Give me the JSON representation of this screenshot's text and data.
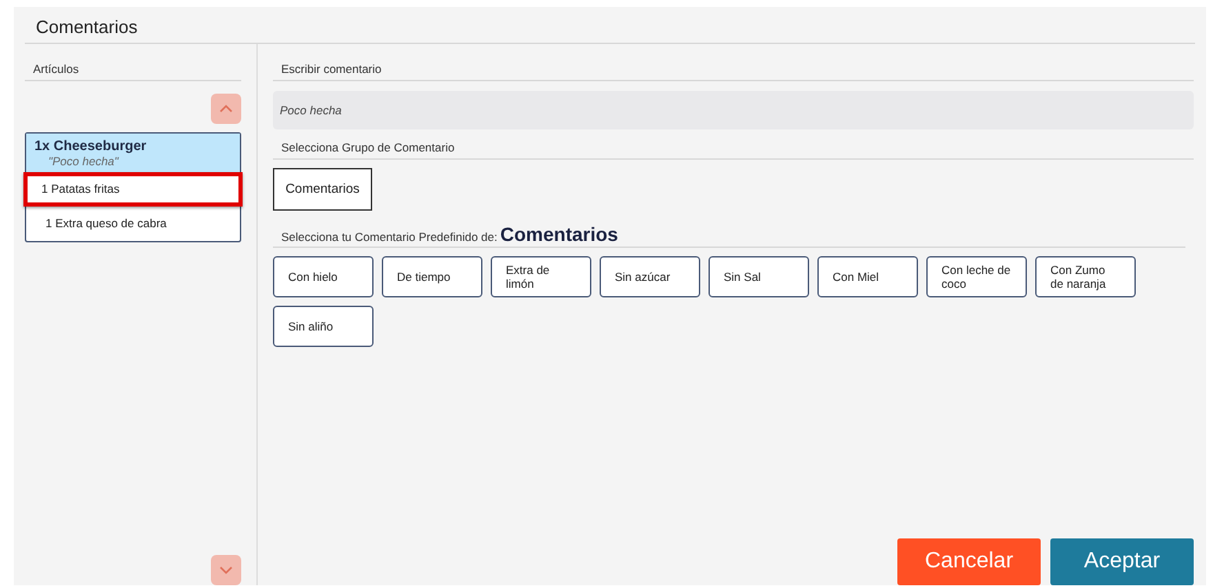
{
  "title": "Comentarios",
  "articles": {
    "heading": "Artículos",
    "items": [
      {
        "name": "1x Cheeseburger",
        "comment": "\"Poco hecha\"",
        "selected": true,
        "extras": [
          {
            "label": "1 Patatas fritas",
            "highlighted": true
          },
          {
            "label": "1 Extra queso de cabra",
            "highlighted": false
          }
        ]
      }
    ]
  },
  "comment_input": {
    "heading": "Escribir comentario",
    "value": "Poco hecha"
  },
  "groups": {
    "heading": "Selecciona Grupo de Comentario",
    "items": [
      {
        "label": "Comentarios",
        "selected": true
      }
    ]
  },
  "predefined": {
    "heading": "Selecciona tu Comentario Predefinido de:",
    "group": "Comentarios",
    "items": [
      "Con hielo",
      "De tiempo",
      "Extra de limón",
      "Sin azúcar",
      "Sin Sal",
      "Con Miel",
      "Con leche de coco",
      "Con Zumo de naranja",
      "Sin aliño"
    ]
  },
  "buttons": [
    {
      "label": "Cancelar",
      "kind": "cancel"
    },
    {
      "label": "Aceptar",
      "kind": "accept"
    }
  ]
}
